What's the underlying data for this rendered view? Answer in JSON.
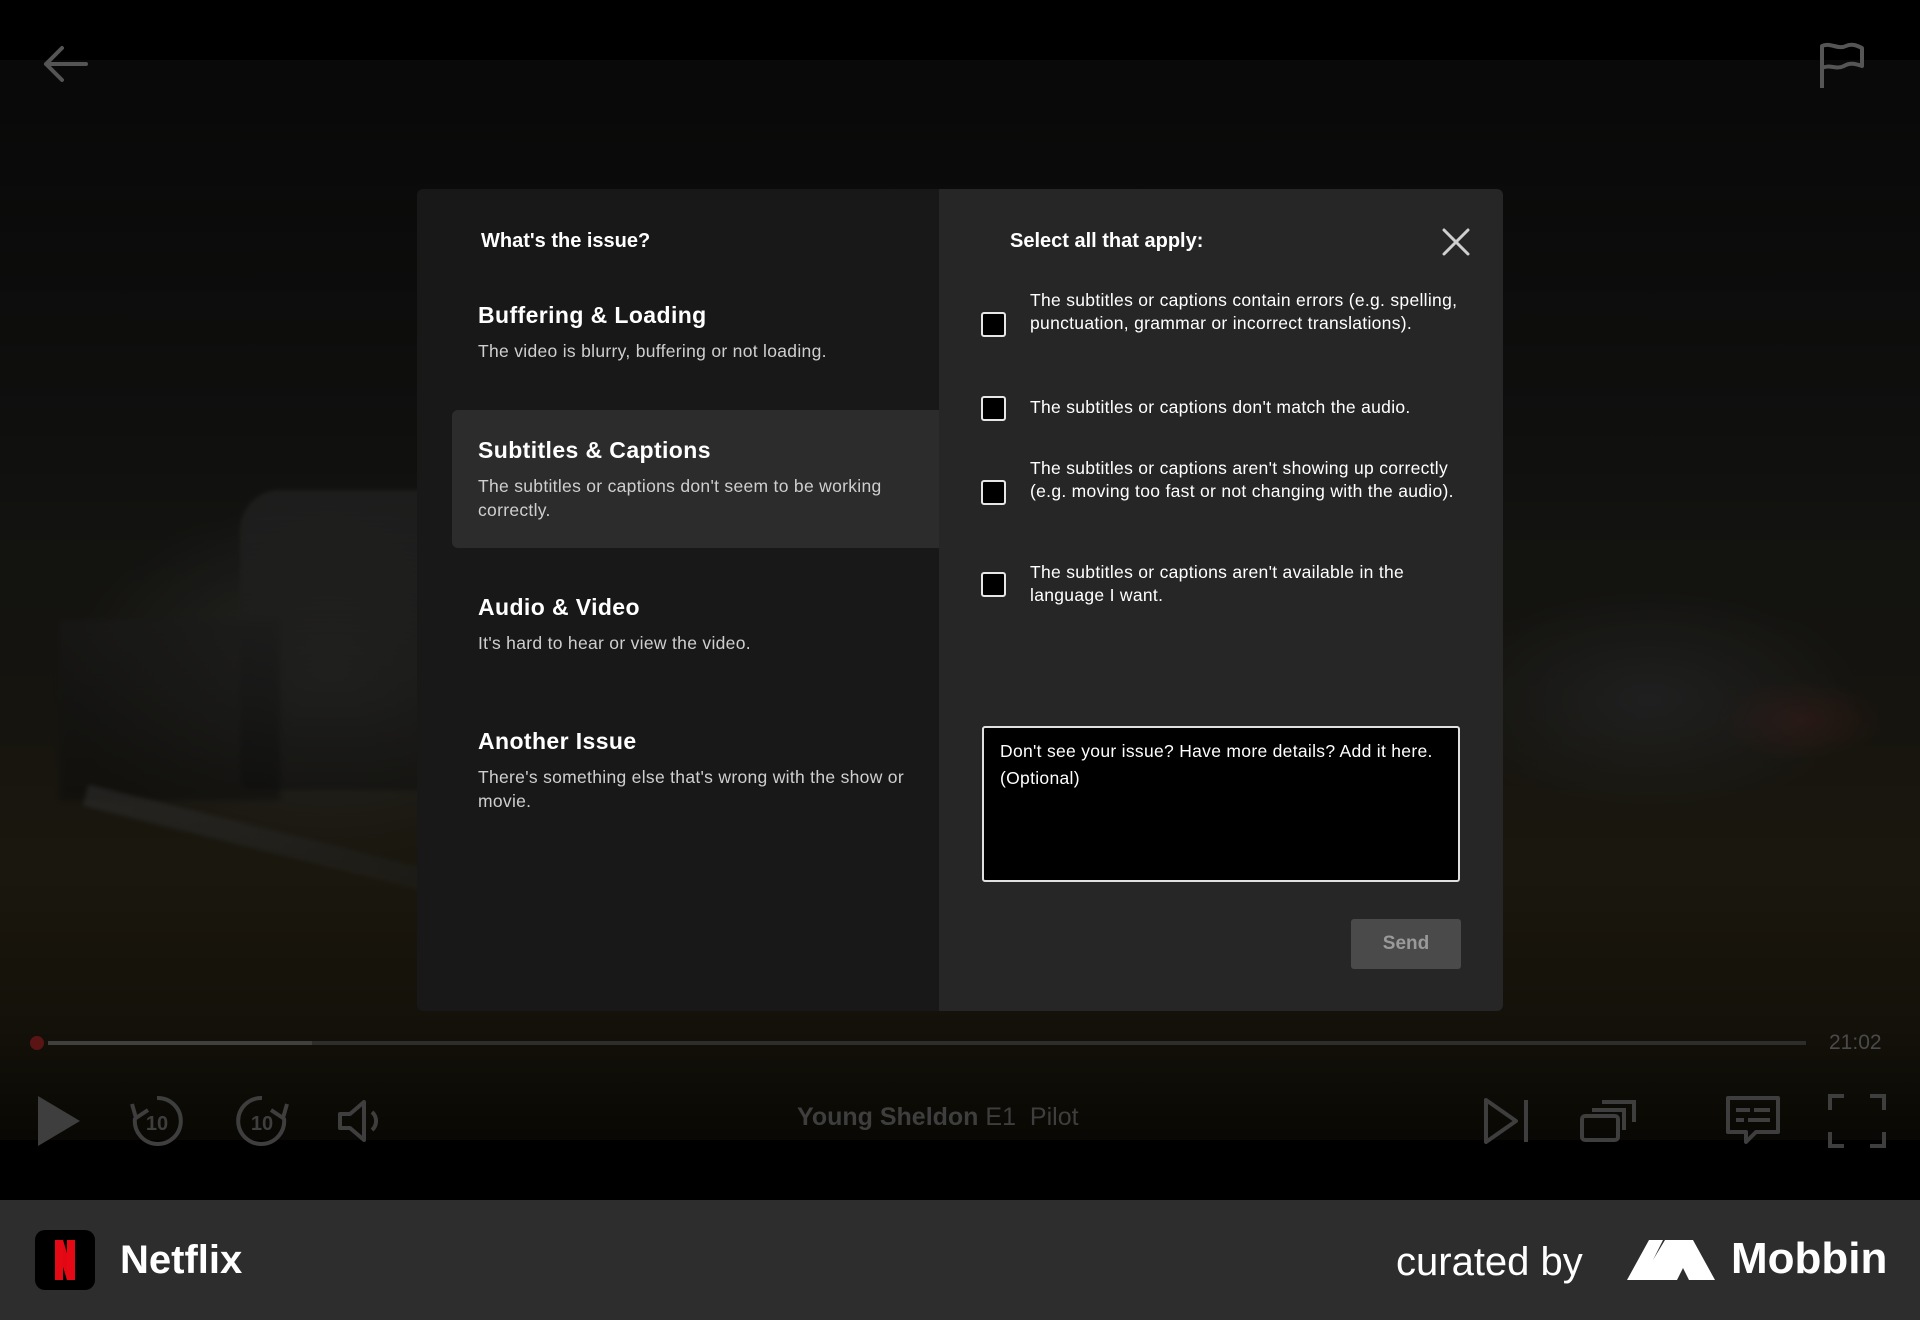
{
  "player": {
    "time_remaining": "21:02",
    "progress": 0.15,
    "show": "Young Sheldon",
    "episode": "E1",
    "episode_title": "Pilot"
  },
  "report_dialog": {
    "left_heading": "What's the issue?",
    "right_heading": "Select all that apply:",
    "issues": [
      {
        "title": "Buffering & Loading",
        "description": "The video is blurry, buffering or not loading.",
        "selected": false
      },
      {
        "title": "Subtitles & Captions",
        "description": "The subtitles or captions don't seem to be working correctly.",
        "selected": true
      },
      {
        "title": "Audio & Video",
        "description": "It's hard to hear or view the video.",
        "selected": false
      },
      {
        "title": "Another Issue",
        "description": "There's something else that's wrong with the show or movie.",
        "selected": false
      }
    ],
    "options": [
      {
        "label": "The subtitles or captions contain errors (e.g. spelling, punctuation, grammar or incorrect translations).",
        "checked": false
      },
      {
        "label": "The subtitles or captions don't match the audio.",
        "checked": false
      },
      {
        "label": "The subtitles or captions aren't showing up correctly (e.g. moving too fast or not changing with the audio).",
        "checked": false
      },
      {
        "label": "The subtitles or captions aren't available in the language I want.",
        "checked": false
      }
    ],
    "details_placeholder": "Don't see your issue? Have more details? Add it here. (Optional)",
    "send_label": "Send"
  },
  "footer": {
    "app_name": "Netflix",
    "curated_by": "curated by",
    "brand": "Mobbin"
  },
  "icons": [
    "back-arrow-icon",
    "flag-icon",
    "close-icon",
    "play-icon",
    "rewind-10-icon",
    "forward-10-icon",
    "volume-icon",
    "next-episode-icon",
    "episodes-icon",
    "subtitles-icon",
    "fullscreen-icon"
  ],
  "colors": {
    "accent": "#e50914",
    "modal_left": "#181818",
    "modal_right": "#262626",
    "send_disabled": "#4a4a4a"
  }
}
